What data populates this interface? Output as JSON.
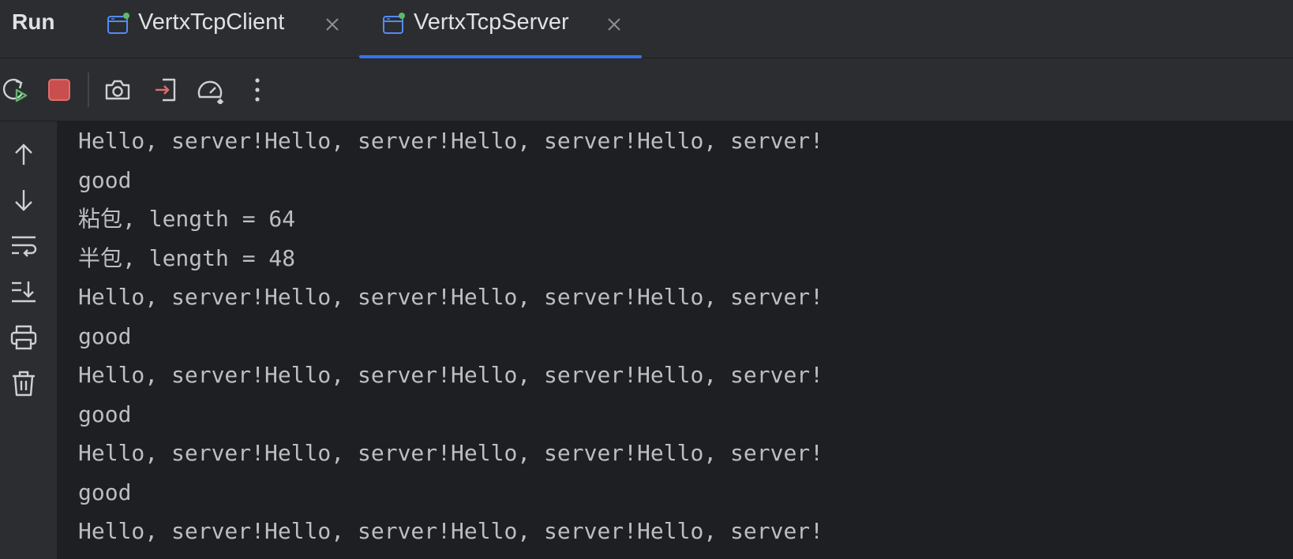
{
  "header": {
    "title": "Run",
    "tabs": [
      {
        "label": "VertxTcpClient",
        "icon": "application-icon",
        "active": false
      },
      {
        "label": "VertxTcpServer",
        "icon": "application-icon",
        "active": true
      }
    ],
    "close_icon": "close-icon",
    "accent_color": "#3574f0"
  },
  "toolbar": {
    "buttons": [
      {
        "name": "rerun",
        "icon": "rerun-icon"
      },
      {
        "name": "stop",
        "icon": "stop-icon",
        "color": "#db5c5c"
      },
      {
        "name": "screenshot",
        "icon": "camera-icon"
      },
      {
        "name": "import",
        "icon": "import-icon"
      },
      {
        "name": "profiler",
        "icon": "gauge-icon"
      },
      {
        "name": "more",
        "icon": "more-vertical-icon"
      }
    ]
  },
  "gutter": {
    "buttons": [
      {
        "name": "scroll-up",
        "icon": "arrow-up-icon"
      },
      {
        "name": "scroll-down",
        "icon": "arrow-down-icon"
      },
      {
        "name": "soft-wrap",
        "icon": "soft-wrap-icon"
      },
      {
        "name": "scroll-to-end",
        "icon": "scroll-to-end-icon"
      },
      {
        "name": "print",
        "icon": "print-icon"
      },
      {
        "name": "clear",
        "icon": "trash-icon"
      }
    ]
  },
  "console": {
    "lines": [
      "Hello, server!Hello, server!Hello, server!Hello, server!",
      "good",
      "粘包, length = 64",
      "半包, length = 48",
      "Hello, server!Hello, server!Hello, server!Hello, server!",
      "good",
      "Hello, server!Hello, server!Hello, server!Hello, server!",
      "good",
      "Hello, server!Hello, server!Hello, server!Hello, server!",
      "good",
      "Hello, server!Hello, server!Hello, server!Hello, server!"
    ]
  }
}
